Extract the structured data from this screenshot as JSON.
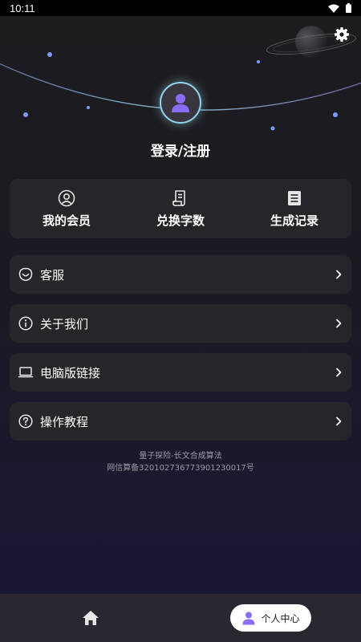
{
  "status_bar": {
    "time": "10:11"
  },
  "profile": {
    "login_text": "登录/注册"
  },
  "quick_actions": [
    {
      "label": "我的会员",
      "icon": "user-circle-icon"
    },
    {
      "label": "兑换字数",
      "icon": "receipt-icon"
    },
    {
      "label": "生成记录",
      "icon": "list-document-icon"
    }
  ],
  "menu": [
    {
      "label": "客服",
      "icon": "customer-service-icon"
    },
    {
      "label": "关于我们",
      "icon": "info-icon"
    },
    {
      "label": "电脑版链接",
      "icon": "laptop-icon"
    },
    {
      "label": "操作教程",
      "icon": "help-icon"
    }
  ],
  "footer": {
    "line1": "量子探险-长文合成算法",
    "line2": "网信算备320102736773901230017号"
  },
  "bottom_nav": {
    "profile_label": "个人中心"
  },
  "colors": {
    "accent": "#8b6cf7",
    "card": "#26252a",
    "ring": "#8fd4e8"
  }
}
